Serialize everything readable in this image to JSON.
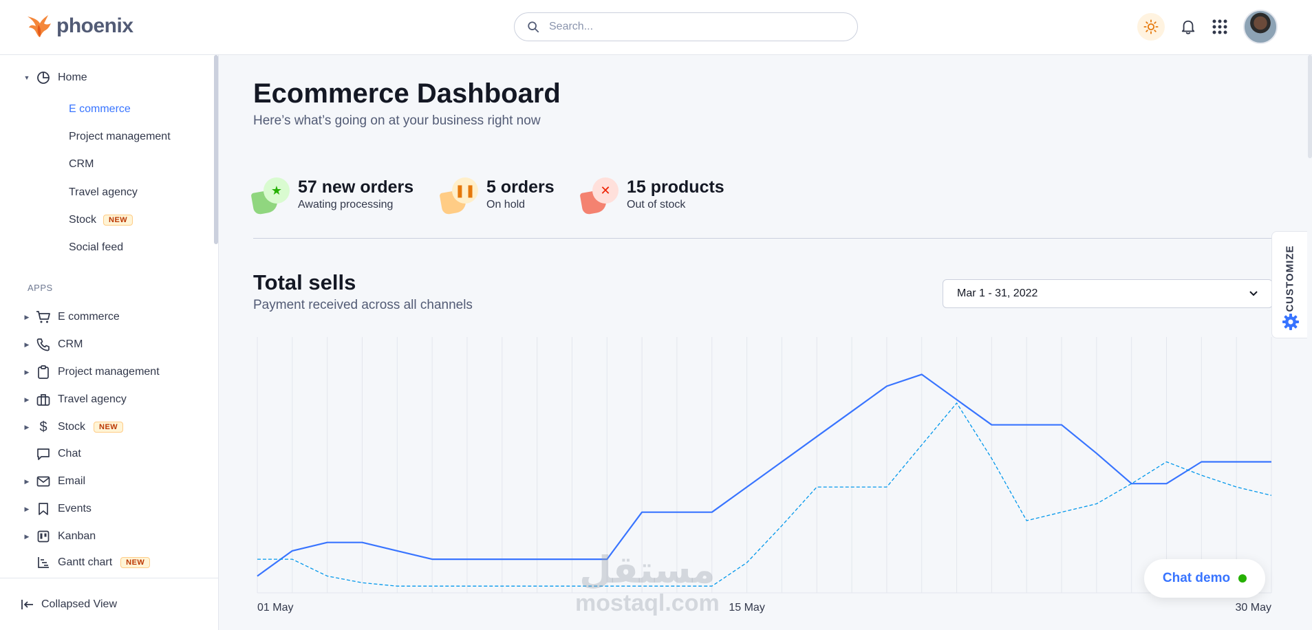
{
  "app": {
    "name": "phoenix"
  },
  "search": {
    "placeholder": "Search..."
  },
  "sidebar": {
    "home": {
      "label": "Home",
      "items": [
        {
          "label": "E commerce",
          "active": true
        },
        {
          "label": "Project management"
        },
        {
          "label": "CRM"
        },
        {
          "label": "Travel agency"
        },
        {
          "label": "Stock",
          "badge": "NEW"
        },
        {
          "label": "Social feed"
        }
      ]
    },
    "apps_label": "APPS",
    "apps": [
      {
        "label": "E commerce",
        "icon": "cart-icon"
      },
      {
        "label": "CRM",
        "icon": "phone-icon"
      },
      {
        "label": "Project management",
        "icon": "clipboard-icon"
      },
      {
        "label": "Travel agency",
        "icon": "briefcase-icon"
      },
      {
        "label": "Stock",
        "icon": "dollar-icon",
        "badge": "NEW"
      },
      {
        "label": "Chat",
        "icon": "message-icon"
      },
      {
        "label": "Email",
        "icon": "mail-icon"
      },
      {
        "label": "Events",
        "icon": "bookmark-icon"
      },
      {
        "label": "Kanban",
        "icon": "kanban-icon"
      },
      {
        "label": "Gantt chart",
        "icon": "gantt-icon",
        "badge": "NEW"
      }
    ],
    "footer": "Collapsed View"
  },
  "header": {
    "title": "Ecommerce Dashboard",
    "subtitle": "Here’s what’s going on at your business right now"
  },
  "stats": [
    {
      "title": "57 new orders",
      "subtitle": "Awating processing",
      "icon": "star-icon",
      "color": "#25b003"
    },
    {
      "title": "5 orders",
      "subtitle": "On hold",
      "icon": "pause-icon",
      "color": "#e5780b"
    },
    {
      "title": "15 products",
      "subtitle": "Out of stock",
      "icon": "x-icon",
      "color": "#ed2000"
    }
  ],
  "total_sells": {
    "title": "Total sells",
    "subtitle": "Payment received across all channels",
    "date_range": "Mar 1 - 31, 2022"
  },
  "chart_data": {
    "type": "line",
    "x": [
      1,
      2,
      3,
      4,
      5,
      6,
      7,
      8,
      9,
      10,
      11,
      12,
      13,
      14,
      15,
      16,
      17,
      18,
      19,
      20,
      21,
      22,
      23,
      24,
      25,
      26,
      27,
      28,
      29,
      30
    ],
    "x_tick_labels": [
      "01 May",
      "15 May",
      "30 May"
    ],
    "y_axis_shown": false,
    "grid": "vertical",
    "series": [
      {
        "style": "solid",
        "color": "#3874ff",
        "values": [
          1,
          2.5,
          3,
          3,
          2.5,
          2,
          2,
          2,
          2,
          2,
          2,
          4.8,
          4.8,
          4.8,
          6.3,
          7.8,
          9.3,
          10.8,
          12.3,
          13,
          11.5,
          10,
          10,
          10,
          8.3,
          6.5,
          6.5,
          7.8,
          7.8,
          7.8
        ]
      },
      {
        "style": "dashed",
        "color": "#0097eb",
        "values": [
          2,
          2,
          1,
          0.6,
          0.4,
          0.4,
          0.4,
          0.4,
          0.4,
          0.4,
          0.4,
          0.4,
          0.4,
          0.4,
          1.8,
          4,
          6.3,
          6.3,
          6.3,
          8.8,
          11.3,
          8,
          4.3,
          4.8,
          5.3,
          6.5,
          7.8,
          7,
          6.3,
          5.8
        ]
      }
    ]
  },
  "customize": {
    "label": "CUSTOMIZE"
  },
  "chat_demo": {
    "label": "Chat demo"
  },
  "watermark": {
    "arabic": "مستقل",
    "latin": "mostaql.com"
  }
}
